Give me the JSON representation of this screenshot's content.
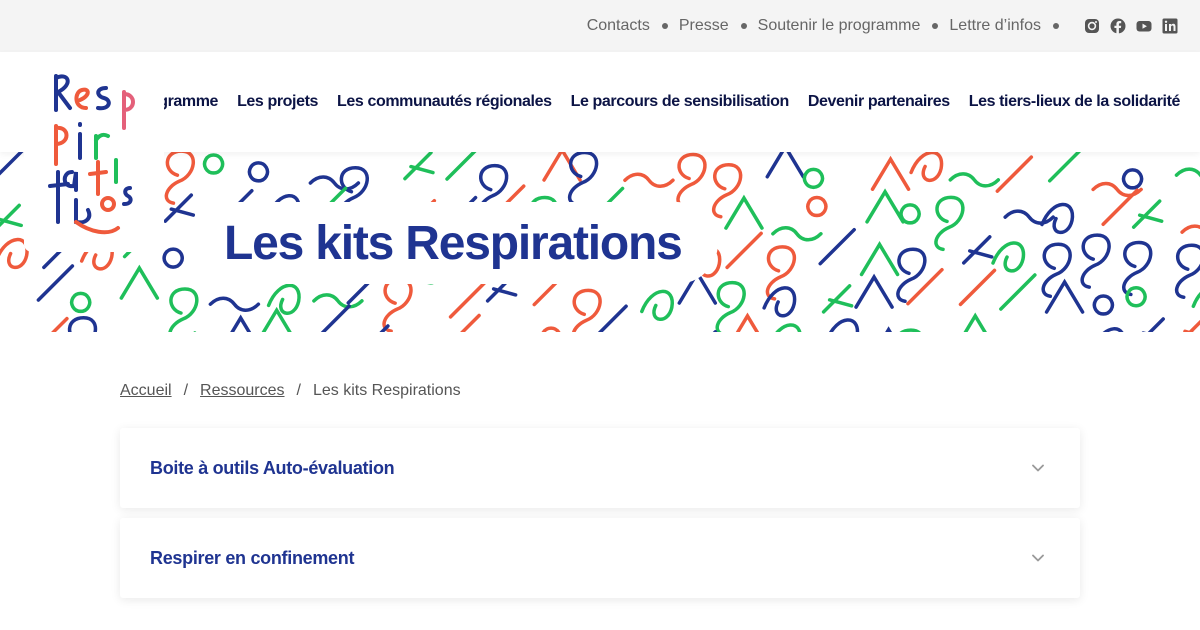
{
  "topbar": {
    "links": [
      {
        "label": "Contacts"
      },
      {
        "label": "Presse"
      },
      {
        "label": "Soutenir le programme"
      },
      {
        "label": "Lettre d’infos"
      }
    ],
    "socials": [
      {
        "icon": "instagram-icon"
      },
      {
        "icon": "facebook-icon"
      },
      {
        "icon": "youtube-icon"
      },
      {
        "icon": "linkedin-icon"
      }
    ]
  },
  "logo": {
    "text": "Respirations",
    "colors": {
      "blue": "#1f3491",
      "red": "#ef5a3c",
      "green": "#1fbf5a",
      "pink": "#e4607a"
    }
  },
  "nav": {
    "items": [
      {
        "label": "Le programme"
      },
      {
        "label": "Les projets"
      },
      {
        "label": "Les communautés régionales"
      },
      {
        "label": "Le parcours de sensibilisation"
      },
      {
        "label": "Devenir partenaires"
      },
      {
        "label": "Les tiers-lieux de la solidarité"
      }
    ]
  },
  "hero": {
    "title": "Les kits Respirations",
    "pattern_colors": [
      "#1f3491",
      "#ef5a3c",
      "#1fbf5a"
    ]
  },
  "breadcrumb": {
    "items": [
      {
        "label": "Accueil"
      },
      {
        "label": "Ressources"
      }
    ],
    "current": "Les kits Respirations",
    "separator": "/"
  },
  "accordion": {
    "items": [
      {
        "title": "Boite à outils Auto-évaluation"
      },
      {
        "title": "Respirer en confinement"
      }
    ]
  },
  "colors": {
    "primary": "#1f3491",
    "topbar_bg": "#f4f4f4",
    "muted_text": "#666666"
  }
}
